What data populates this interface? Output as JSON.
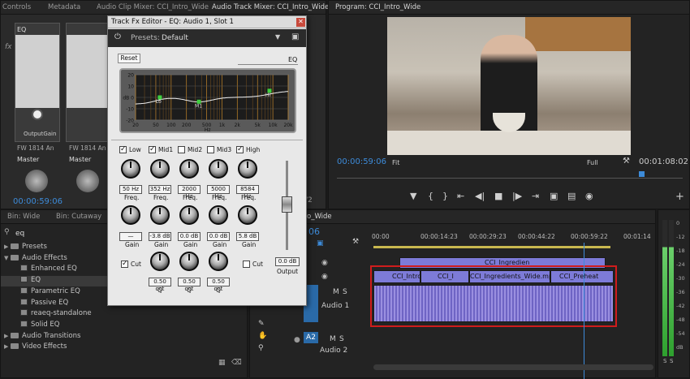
{
  "top_left_tabs": {
    "controls": "Controls",
    "metadata": "Metadata",
    "audio_clip_mixer": "Audio Clip Mixer: CCI_Intro_Wide",
    "audio_track_mixer": "Audio Track Mixer: CCI_Intro_Wide"
  },
  "mixer": {
    "fx_label": "fx",
    "slot1": "EQ",
    "output_gain": "OutputGain",
    "channel1_name": "FW 1814 An",
    "channel2_name": "FW 1814 An",
    "output1": "Master",
    "output2": "Master",
    "timecode": "00:00:59:06"
  },
  "fx_editor": {
    "title": "Track Fx Editor - EQ: Audio 1, Slot 1",
    "presets_label": "Presets:",
    "preset_value": "Default",
    "reset_label": "Reset",
    "eq_label": "EQ",
    "db_labels": [
      "20",
      "10",
      "dB 0",
      "-10",
      "-20"
    ],
    "freq_labels": [
      "20",
      "50",
      "100",
      "200",
      "500",
      "1k",
      "2k",
      "5k",
      "10k",
      "20k"
    ],
    "hz_label": "Hz",
    "points": [
      "Lo",
      "M1",
      "Hi"
    ],
    "bands": [
      {
        "name": "Low",
        "enabled": true,
        "freq": "50 Hz",
        "gain": "—",
        "q": ""
      },
      {
        "name": "Mid1",
        "enabled": true,
        "freq": "352 Hz",
        "gain": "-3.8 dB",
        "q": "0.50 oct"
      },
      {
        "name": "Mid2",
        "enabled": false,
        "freq": "2000 Hz",
        "gain": "0.0 dB",
        "q": "0.50 oct"
      },
      {
        "name": "Mid3",
        "enabled": false,
        "freq": "5000 Hz",
        "gain": "0.0 dB",
        "q": "0.50 oct"
      },
      {
        "name": "High",
        "enabled": true,
        "freq": "8584 Hz",
        "gain": "5.8 dB",
        "q": ""
      }
    ],
    "freq_label": "Freq.",
    "gain_label": "Gain",
    "q_label": "Q",
    "cut_label": "Cut",
    "output_value": "0.0 dB",
    "output_label": "Output"
  },
  "program": {
    "tab_title": "Program: CCI_Intro_Wide",
    "timecode": "00:00:59:06",
    "fit": "Fit",
    "quality": "Full",
    "duration": "00:01:08:02"
  },
  "effects": {
    "tab_bin_wide": "Bin: Wide",
    "tab_bin_cutaway": "Bin: Cutaway",
    "search_value": "eq",
    "items": [
      {
        "label": "Presets",
        "type": "folder",
        "indent": 0,
        "open": false
      },
      {
        "label": "Audio Effects",
        "type": "folder",
        "indent": 0,
        "open": true
      },
      {
        "label": "Enhanced EQ",
        "type": "fx",
        "indent": 1
      },
      {
        "label": "EQ",
        "type": "fx",
        "indent": 1,
        "selected": true
      },
      {
        "label": "Parametric EQ",
        "type": "fx",
        "indent": 1
      },
      {
        "label": "Passive EQ",
        "type": "fx",
        "indent": 1
      },
      {
        "label": "reaeq-standalone",
        "type": "fx",
        "indent": 1
      },
      {
        "label": "Solid EQ",
        "type": "fx",
        "indent": 1
      },
      {
        "label": "Audio Transitions",
        "type": "folder",
        "indent": 0,
        "open": false
      },
      {
        "label": "Video Effects",
        "type": "folder",
        "indent": 0,
        "open": false
      }
    ]
  },
  "timeline": {
    "tab_title": "o_Wide",
    "timecode": "06",
    "ruler": [
      "00:00",
      "00:00:14:23",
      "00:00:29:23",
      "00:00:44:22",
      "00:00:59:22",
      "00:01:14"
    ],
    "clips_v1": [
      "CCI_Intro_",
      "CCI_I",
      "CCI_Ingredients_Wide.mp4",
      "CCI_Preheat"
    ],
    "clip_v2": "CCI_Ingredien",
    "audio1": "Audio 1",
    "audio2": "Audio 2",
    "a2": "A2",
    "m": "M",
    "s": "S",
    "panel_num": "/2"
  },
  "meters": {
    "scale": [
      "0",
      "-12",
      "-18",
      "-24",
      "-30",
      "-36",
      "-42",
      "-48",
      "-54",
      "dB"
    ],
    "s1": "S",
    "s2": "S"
  }
}
